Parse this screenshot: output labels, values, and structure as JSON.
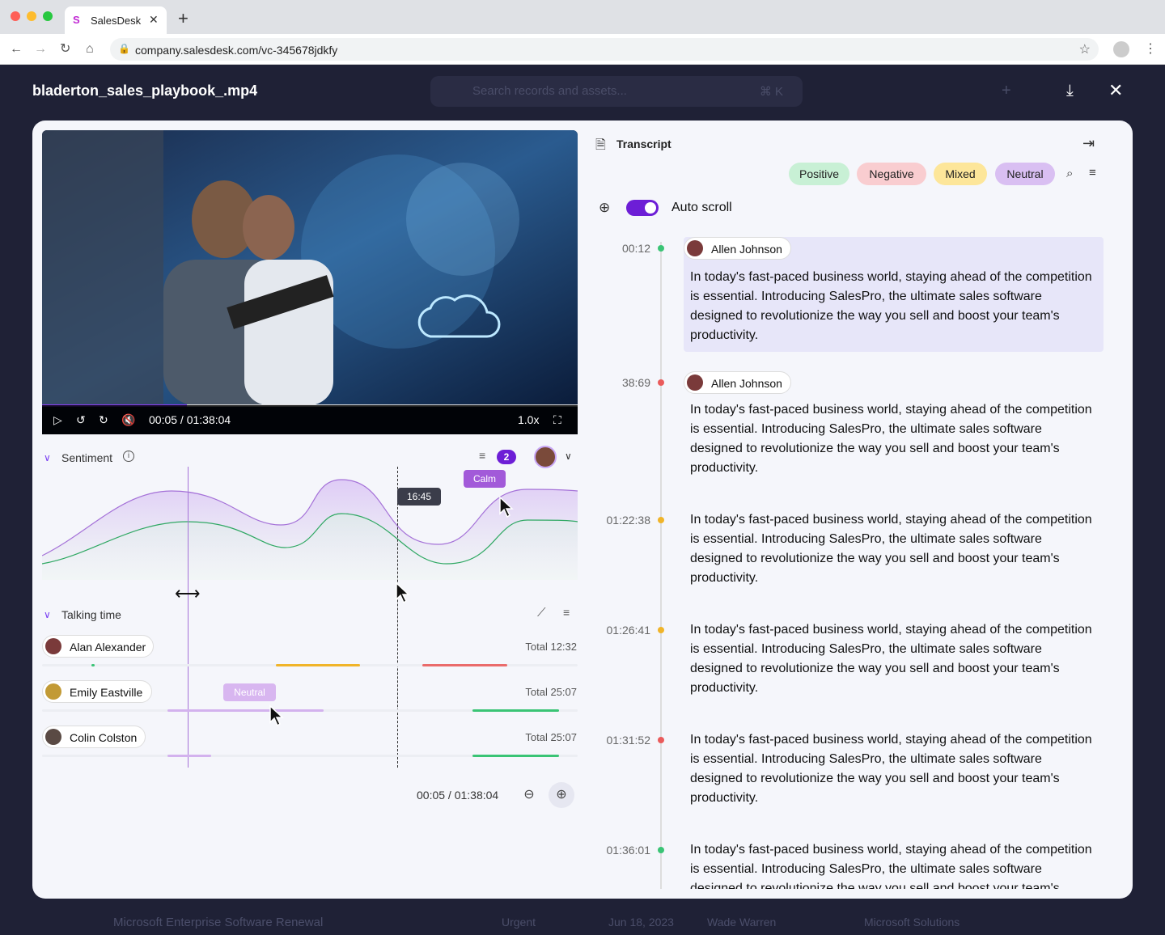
{
  "browser": {
    "tab_title": "SalesDesk",
    "url": "company.salesdesk.com/vc-345678jdkfy"
  },
  "app": {
    "search_placeholder": "Search records and assets...",
    "search_shortcut": "⌘ K",
    "bg_row": {
      "title": "Microsoft Enterprise Software Renewal",
      "status": "Urgent",
      "date": "Jun 18, 2023",
      "owner": "Wade Warren",
      "company": "Microsoft Solutions"
    }
  },
  "modal": {
    "file_title": "bladerton_sales_playbook_.mp4",
    "video": {
      "time": "00:05 / 01:38:04",
      "speed": "1.0x",
      "progress": 0.27
    },
    "sentiment": {
      "title": "Sentiment",
      "filter_count": "2",
      "tooltip_time": "16:45",
      "tooltip_label": "Calm"
    },
    "talking_time": {
      "title": "Talking time",
      "hover_label": "Neutral",
      "speakers": [
        {
          "name": "Alan Alexander",
          "total": "Total 12:32"
        },
        {
          "name": "Emily Eastville",
          "total": "Total 25:07"
        },
        {
          "name": "Colin Colston",
          "total": "Total 25:07"
        }
      ],
      "footer_time": "00:05 / 01:38:04"
    },
    "transcript": {
      "title": "Transcript",
      "filters": [
        "Positive",
        "Negative",
        "Mixed",
        "Neutral"
      ],
      "auto_scroll": "Auto scroll",
      "entries": [
        {
          "time": "00:12",
          "speaker": "Allen Johnson",
          "text": "In today's fast-paced business world, staying ahead of the competition is essential. Introducing SalesPro, the ultimate sales software designed to revolutionize the way you sell and boost your team's productivity."
        },
        {
          "time": "38:69",
          "speaker": "Allen Johnson",
          "text": "In today's fast-paced business world, staying ahead of the competition is essential. Introducing SalesPro, the ultimate sales software designed to revolutionize the way you sell and boost your team's productivity."
        },
        {
          "time": "01:22:38",
          "text": "In today's fast-paced business world, staying ahead of the competition is essential. Introducing SalesPro, the ultimate sales software designed to revolutionize the way you sell and boost your team's productivity."
        },
        {
          "time": "01:26:41",
          "text": "In today's fast-paced business world, staying ahead of the competition is essential. Introducing SalesPro, the ultimate sales software designed to revolutionize the way you sell and boost your team's productivity."
        },
        {
          "time": "01:31:52",
          "text": "In today's fast-paced business world, staying ahead of the competition is essential. Introducing SalesPro, the ultimate sales software designed to revolutionize the way you sell and boost your team's productivity."
        },
        {
          "time": "01:36:01",
          "text": "In today's fast-paced business world, staying ahead of the competition is essential. Introducing SalesPro, the ultimate sales software designed to revolutionize the way you sell and boost your team's productivity."
        }
      ]
    }
  },
  "colors": {
    "accent": "#6d1ed6",
    "positive": "#c8f0d5",
    "negative": "#f9cdd0",
    "mixed": "#fde69a",
    "neutral": "#d9bff2"
  }
}
